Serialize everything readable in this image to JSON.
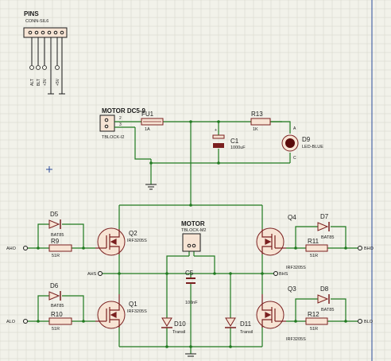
{
  "pins_header": {
    "ref": "PINS",
    "value": "CONN-SIL6",
    "pin_labels": [
      "ALT",
      "BLT",
      "+3V",
      "+5V"
    ]
  },
  "j_motor_dc": {
    "ref": "MOTOR DC5-9",
    "value": "TBLOCK-I2",
    "pins": [
      "2",
      "3"
    ]
  },
  "fuse": {
    "ref": "FU1",
    "value": "1A"
  },
  "resistors": [
    {
      "ref": "R13",
      "value": "1K"
    },
    {
      "ref": "R9",
      "value": "51R"
    },
    {
      "ref": "R10",
      "value": "51R"
    },
    {
      "ref": "R11",
      "value": "51R"
    },
    {
      "ref": "R12",
      "value": "51R"
    }
  ],
  "capacitors": [
    {
      "ref": "C1",
      "value": "1000uF"
    },
    {
      "ref": "C5",
      "value": "100nF"
    }
  ],
  "led": {
    "ref": "D9",
    "value": "LED-BLUE",
    "pins": [
      "A",
      "C"
    ]
  },
  "diodes": [
    {
      "ref": "D5",
      "value": "BAT85"
    },
    {
      "ref": "D6",
      "value": "BAT85"
    },
    {
      "ref": "D7",
      "value": "BAT85"
    },
    {
      "ref": "D8",
      "value": "BAT85"
    },
    {
      "ref": "D10",
      "value": "Transil"
    },
    {
      "ref": "D11",
      "value": "Transil"
    }
  ],
  "mosfets": [
    {
      "ref": "Q1",
      "value": "IRF3205S"
    },
    {
      "ref": "Q2",
      "value": "IRF3205S"
    },
    {
      "ref": "Q3",
      "value": "IRF3205S"
    },
    {
      "ref": "Q4",
      "value": "IRF3205S"
    }
  ],
  "motor": {
    "ref": "MOTOR",
    "value": "TBLOCK-M2"
  },
  "net_labels": {
    "aho": "AHO",
    "alo": "ALO",
    "bho": "BHO",
    "blo": "BLO",
    "ahs": "AHS",
    "bhs": "BHS"
  }
}
